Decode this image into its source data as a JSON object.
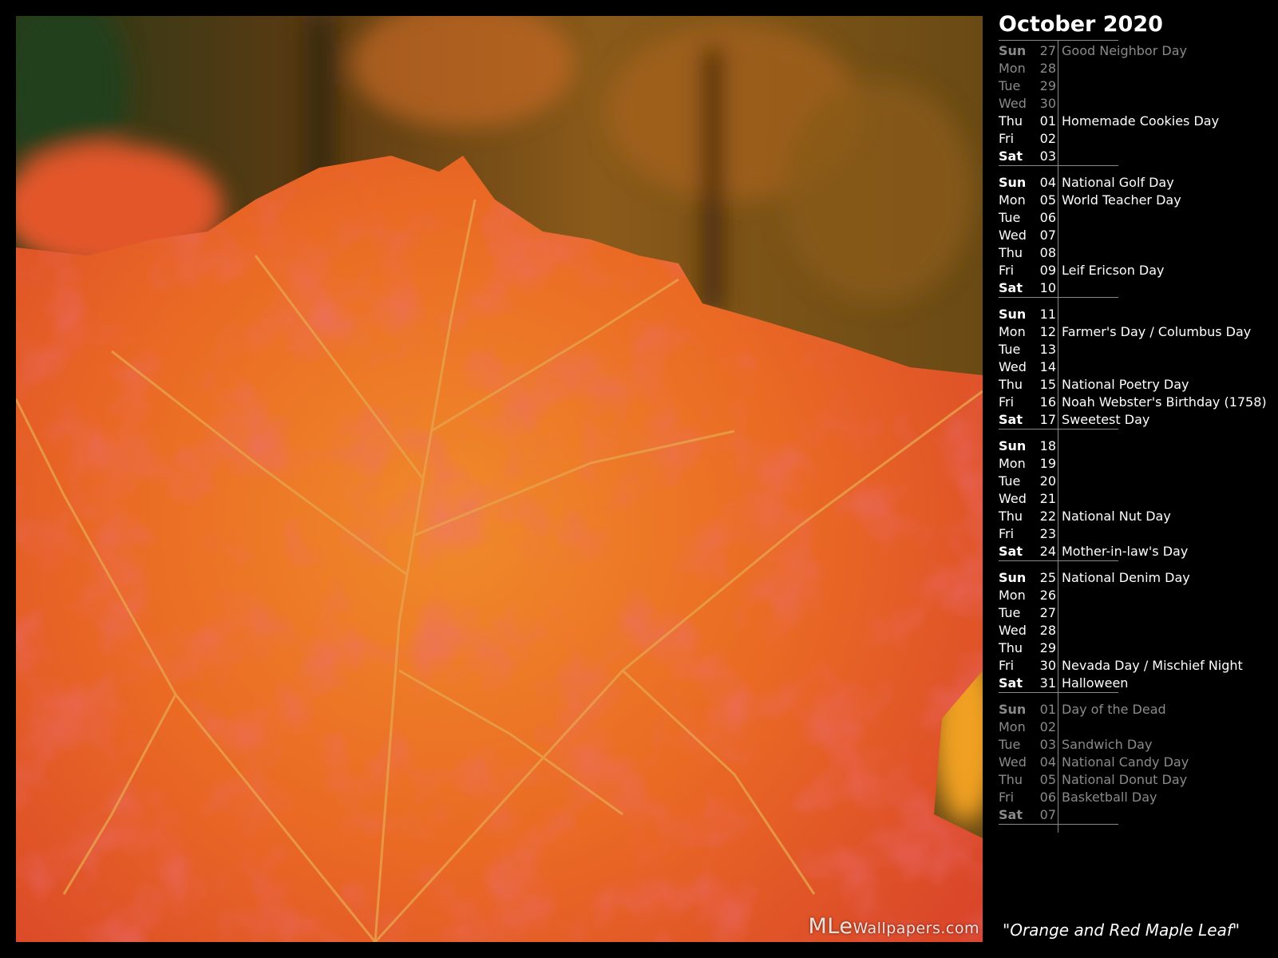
{
  "calendar": {
    "title": "October 2020",
    "weeks": [
      [
        {
          "wd": "Sun",
          "d": "27",
          "ev": "Good Neighbor Day",
          "dim": true
        },
        {
          "wd": "Mon",
          "d": "28",
          "ev": "",
          "dim": true
        },
        {
          "wd": "Tue",
          "d": "29",
          "ev": "",
          "dim": true
        },
        {
          "wd": "Wed",
          "d": "30",
          "ev": "",
          "dim": true
        },
        {
          "wd": "Thu",
          "d": "01",
          "ev": "Homemade Cookies Day",
          "dim": false
        },
        {
          "wd": "Fri",
          "d": "02",
          "ev": "",
          "dim": false
        },
        {
          "wd": "Sat",
          "d": "03",
          "ev": "",
          "dim": false
        }
      ],
      [
        {
          "wd": "Sun",
          "d": "04",
          "ev": "National Golf Day",
          "dim": false
        },
        {
          "wd": "Mon",
          "d": "05",
          "ev": "World Teacher Day",
          "dim": false
        },
        {
          "wd": "Tue",
          "d": "06",
          "ev": "",
          "dim": false
        },
        {
          "wd": "Wed",
          "d": "07",
          "ev": "",
          "dim": false
        },
        {
          "wd": "Thu",
          "d": "08",
          "ev": "",
          "dim": false
        },
        {
          "wd": "Fri",
          "d": "09",
          "ev": "Leif Ericson Day",
          "dim": false
        },
        {
          "wd": "Sat",
          "d": "10",
          "ev": "",
          "dim": false
        }
      ],
      [
        {
          "wd": "Sun",
          "d": "11",
          "ev": "",
          "dim": false
        },
        {
          "wd": "Mon",
          "d": "12",
          "ev": "Farmer's Day / Columbus Day",
          "dim": false
        },
        {
          "wd": "Tue",
          "d": "13",
          "ev": "",
          "dim": false
        },
        {
          "wd": "Wed",
          "d": "14",
          "ev": "",
          "dim": false
        },
        {
          "wd": "Thu",
          "d": "15",
          "ev": "National Poetry Day",
          "dim": false
        },
        {
          "wd": "Fri",
          "d": "16",
          "ev": "Noah Webster's Birthday (1758)",
          "dim": false
        },
        {
          "wd": "Sat",
          "d": "17",
          "ev": "Sweetest Day",
          "dim": false
        }
      ],
      [
        {
          "wd": "Sun",
          "d": "18",
          "ev": "",
          "dim": false
        },
        {
          "wd": "Mon",
          "d": "19",
          "ev": "",
          "dim": false
        },
        {
          "wd": "Tue",
          "d": "20",
          "ev": "",
          "dim": false
        },
        {
          "wd": "Wed",
          "d": "21",
          "ev": "",
          "dim": false
        },
        {
          "wd": "Thu",
          "d": "22",
          "ev": "National Nut Day",
          "dim": false
        },
        {
          "wd": "Fri",
          "d": "23",
          "ev": "",
          "dim": false
        },
        {
          "wd": "Sat",
          "d": "24",
          "ev": "Mother-in-law's Day",
          "dim": false
        }
      ],
      [
        {
          "wd": "Sun",
          "d": "25",
          "ev": "National Denim Day",
          "dim": false
        },
        {
          "wd": "Mon",
          "d": "26",
          "ev": "",
          "dim": false
        },
        {
          "wd": "Tue",
          "d": "27",
          "ev": "",
          "dim": false
        },
        {
          "wd": "Wed",
          "d": "28",
          "ev": "",
          "dim": false
        },
        {
          "wd": "Thu",
          "d": "29",
          "ev": "",
          "dim": false
        },
        {
          "wd": "Fri",
          "d": "30",
          "ev": "Nevada Day / Mischief Night",
          "dim": false
        },
        {
          "wd": "Sat",
          "d": "31",
          "ev": "Halloween",
          "dim": false
        }
      ],
      [
        {
          "wd": "Sun",
          "d": "01",
          "ev": "Day of the Dead",
          "dim": true
        },
        {
          "wd": "Mon",
          "d": "02",
          "ev": "",
          "dim": true
        },
        {
          "wd": "Tue",
          "d": "03",
          "ev": "Sandwich Day",
          "dim": true
        },
        {
          "wd": "Wed",
          "d": "04",
          "ev": "National Candy Day",
          "dim": true
        },
        {
          "wd": "Thu",
          "d": "05",
          "ev": "National Donut Day",
          "dim": true
        },
        {
          "wd": "Fri",
          "d": "06",
          "ev": "Basketball Day",
          "dim": true
        },
        {
          "wd": "Sat",
          "d": "07",
          "ev": "",
          "dim": true
        }
      ]
    ]
  },
  "caption": "\"Orange and Red Maple Leaf\"",
  "watermark": {
    "prefix": "MLe",
    "suffix": "Wallpapers.com"
  },
  "colors": {
    "text": "#ffffff",
    "dim_text": "#8a8a8a",
    "background": "#000000"
  }
}
